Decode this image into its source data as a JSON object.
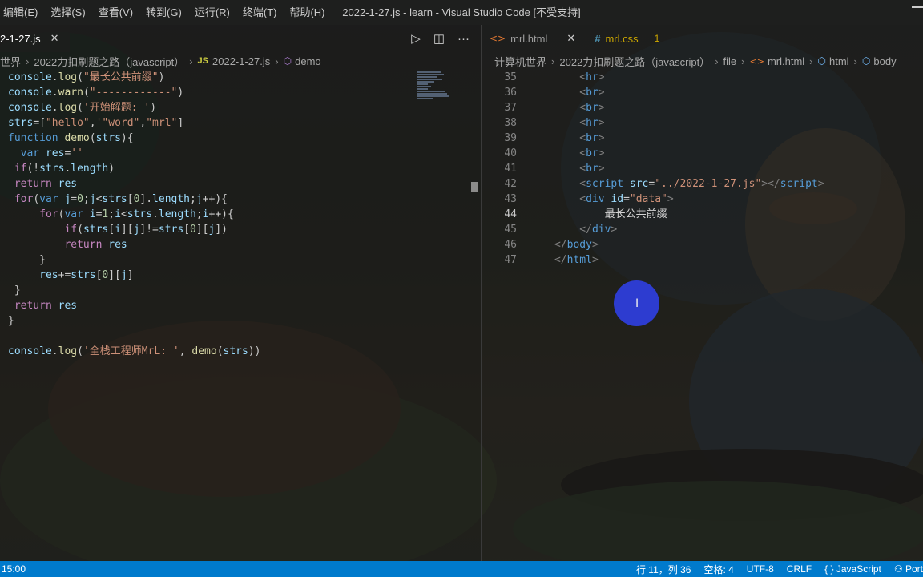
{
  "menu": [
    "编辑(E)",
    "选择(S)",
    "查看(V)",
    "转到(G)",
    "运行(R)",
    "终端(T)",
    "帮助(H)"
  ],
  "window_title": "2022-1-27.js - learn - Visual Studio Code [不受支持]",
  "left_editor": {
    "tab_label": "2-1-27.js",
    "tab_close": "✕",
    "breadcrumb": [
      "世界",
      "2022力扣刷题之路（javascript）",
      "2022-1-27.js",
      "demo"
    ],
    "breadcrumb_js_badge": "JS"
  },
  "right_editor": {
    "tabs": [
      {
        "label": "mrl.html",
        "close": "✕"
      },
      {
        "label": "mrl.css",
        "badge": "1"
      }
    ],
    "breadcrumb": [
      "计算机世界",
      "2022力扣刷题之路（javascript）",
      "file",
      "mrl.html",
      "html",
      "body"
    ],
    "line_numbers": [
      "35",
      "36",
      "37",
      "38",
      "39",
      "40",
      "41",
      "42",
      "43",
      "44",
      "45",
      "46",
      "47"
    ],
    "active_line": "44",
    "inner_text": "最长公共前缀"
  },
  "status": {
    "left": "15:00",
    "position": "行 11，列 36",
    "indent": "空格: 4",
    "encoding": "UTF-8",
    "eol": "CRLF",
    "language": "JavaScript",
    "port": "Port",
    "language_icon": "{ }"
  },
  "icons": {
    "run": "run-icon",
    "split": "split-editor-icon",
    "more": "more-actions-icon"
  }
}
